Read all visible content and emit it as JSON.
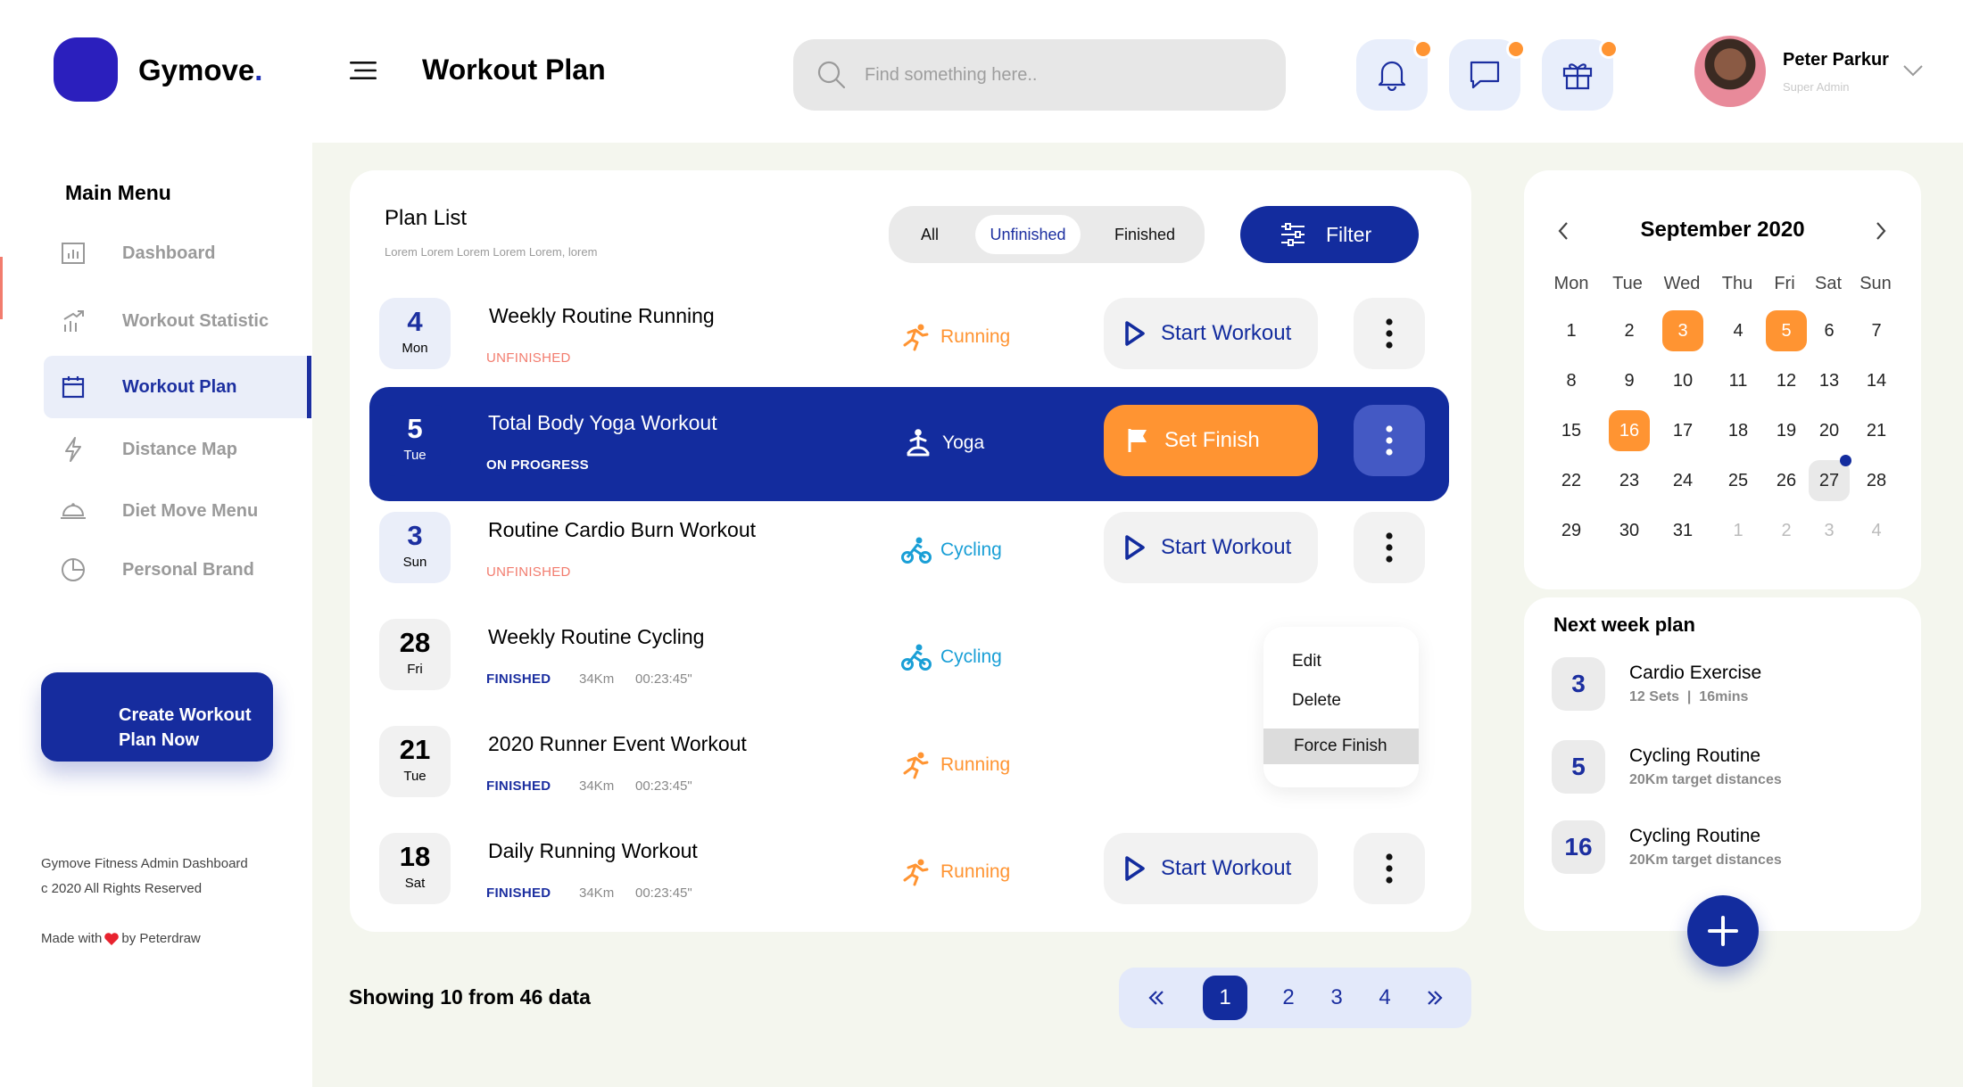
{
  "brand": {
    "name_main": "Gymove",
    "name_dot": "."
  },
  "header": {
    "title": "Workout Plan",
    "search_placeholder": "Find something here..",
    "user": {
      "name": "Peter Parkur",
      "role": "Super Admin"
    }
  },
  "sidebar": {
    "menu_title": "Main Menu",
    "items": [
      {
        "label": "Dashboard",
        "icon": "bar-chart-icon"
      },
      {
        "label": "Workout Statistic",
        "icon": "trend-icon"
      },
      {
        "label": "Workout Plan",
        "icon": "calendar-icon",
        "active": true
      },
      {
        "label": "Distance Map",
        "icon": "lightning-icon"
      },
      {
        "label": "Diet Move Menu",
        "icon": "cloche-icon"
      },
      {
        "label": "Personal Brand",
        "icon": "pie-icon"
      }
    ],
    "cta_line1": "Create Workout",
    "cta_line2": "Plan Now",
    "footer_line1": "Gymove Fitness Admin Dashboard",
    "footer_line2": "c 2020 All Rights Reserved",
    "made_with": "Made with",
    "made_by": "by Peterdraw"
  },
  "plan_list": {
    "title": "Plan List",
    "subtitle": "Lorem Lorem Lorem Lorem Lorem, lorem",
    "tabs": [
      "All",
      "Unfinished",
      "Finished"
    ],
    "active_tab": "Unfinished",
    "filter_label": "Filter",
    "rows": [
      {
        "day": "4",
        "dow": "Mon",
        "name": "Weekly Routine Running",
        "status": "UNFINISHED",
        "activity": "Running",
        "action": "Start Workout"
      },
      {
        "day": "5",
        "dow": "Tue",
        "name": "Total Body Yoga Workout",
        "status": "ON PROGRESS",
        "activity": "Yoga",
        "action": "Set Finish"
      },
      {
        "day": "3",
        "dow": "Sun",
        "name": "Routine Cardio Burn Workout",
        "status": "UNFINISHED",
        "activity": "Cycling",
        "action": "Start Workout"
      },
      {
        "day": "28",
        "dow": "Fri",
        "name": "Weekly Routine Cycling",
        "status": "FINISHED",
        "distance": "34Km",
        "time": "00:23:45\"",
        "activity": "Cycling"
      },
      {
        "day": "21",
        "dow": "Tue",
        "name": "2020 Runner Event Workout",
        "status": "FINISHED",
        "distance": "34Km",
        "time": "00:23:45\"",
        "activity": "Running"
      },
      {
        "day": "18",
        "dow": "Sat",
        "name": "Daily Running Workout",
        "status": "FINISHED",
        "distance": "34Km",
        "time": "00:23:45\"",
        "activity": "Running",
        "action": "Start Workout"
      }
    ],
    "dropdown": [
      "Edit",
      "Delete",
      "Force Finish"
    ]
  },
  "pagination": {
    "showing": "Showing 10 from 46 data",
    "pages": [
      "1",
      "2",
      "3",
      "4"
    ],
    "current": "1"
  },
  "calendar": {
    "month": "September 2020",
    "weekdays": [
      "Mon",
      "Tue",
      "Wed",
      "Thu",
      "Fri",
      "Sat",
      "Sun"
    ],
    "weeks": [
      [
        "1",
        "2",
        "3",
        "4",
        "5",
        "6",
        "7"
      ],
      [
        "8",
        "9",
        "10",
        "11",
        "12",
        "13",
        "14"
      ],
      [
        "15",
        "16",
        "17",
        "18",
        "19",
        "20",
        "21"
      ],
      [
        "22",
        "23",
        "24",
        "25",
        "26",
        "27",
        "28"
      ],
      [
        "29",
        "30",
        "31",
        "1",
        "2",
        "3",
        "4"
      ]
    ],
    "highlighted": [
      "3",
      "5",
      "16"
    ],
    "today": "27"
  },
  "next_week": {
    "title": "Next week plan",
    "items": [
      {
        "day": "3",
        "title": "Cardio Exercise",
        "sub": "12 Sets  |  16mins"
      },
      {
        "day": "5",
        "title": "Cycling Routine",
        "sub": "20Km target distances"
      },
      {
        "day": "16",
        "title": "Cycling Routine",
        "sub": "20Km target distances"
      }
    ]
  },
  "colors": {
    "primary": "#132C9E",
    "accent": "#FF9432",
    "unfinished": "#F27C6E",
    "cycling": "#1A9FD6",
    "background": "#F4F6EE"
  }
}
